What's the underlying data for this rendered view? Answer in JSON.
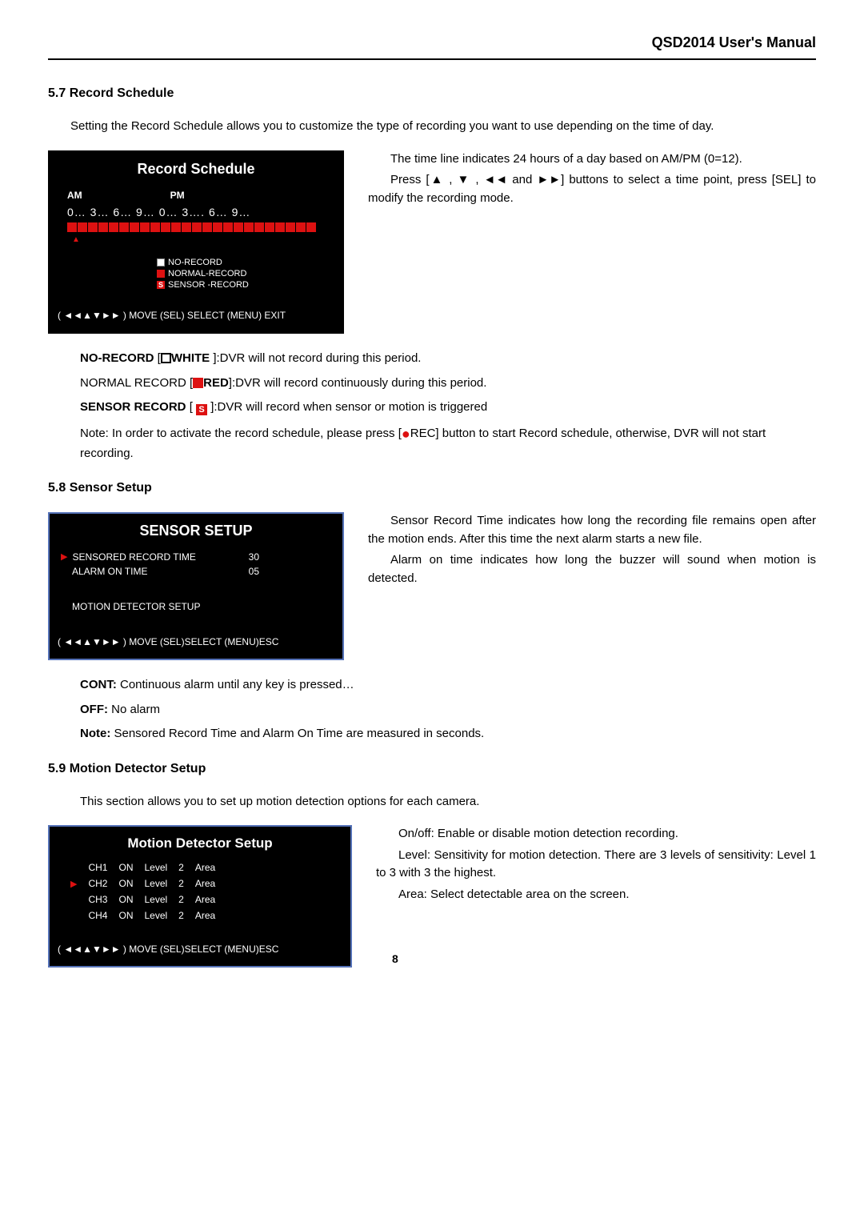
{
  "header": {
    "title": "QSD2014 User's Manual"
  },
  "s57": {
    "title": "5.7 Record Schedule",
    "intro": "Setting the Record Schedule allows you to customize the type of recording you want to use depending on the time of day.",
    "scr": {
      "title": "Record Schedule",
      "am": "AM",
      "pm": "PM",
      "timeline": "0… 3… 6… 9… 0… 3…. 6… 9…",
      "legend1": "NO-RECORD",
      "legend2": "NORMAL-RECORD",
      "legend3_prefix": "S",
      "legend3": "SENSOR -RECORD",
      "footer": "(  ◄◄▲▼►►  ) MOVE (SEL) SELECT (MENU) EXIT"
    },
    "right1": "The time line indicates 24 hours of a day based on AM/PM (0=12).",
    "right2": "Press [▲ , ▼ , ◄◄ and ►►] buttons to select a time point, press [SEL] to modify the recording mode.",
    "nr_label": "NO-RECORD",
    "nr_white": "WHITE",
    "nr_text": " ]:DVR will not record during this period.",
    "norm_label": "NORMAL RECORD [",
    "norm_red": "RED",
    "norm_text": "]:DVR will record continuously during this period.",
    "sr_label": "SENSOR RECORD",
    "sr_s": "S",
    "sr_text": " ]:DVR will record when sensor or motion is triggered",
    "note1": "Note: In order to activate the record schedule, please press [",
    "note_rec": "REC] button to start Record schedule, otherwise, DVR will not start recording."
  },
  "s58": {
    "title": "5.8 Sensor Setup",
    "scr": {
      "title": "SENSOR SETUP",
      "row1": "SENSORED RECORD TIME",
      "row1v": "30",
      "row2": "ALARM ON TIME",
      "row2v": "05",
      "row3": "MOTION DETECTOR SETUP",
      "footer": "(  ◄◄▲▼►►  ) MOVE (SEL)SELECT   (MENU)ESC"
    },
    "right1": "Sensor Record Time indicates how long the recording file remains open after the motion ends. After this time the next alarm starts a new file.",
    "right2": "Alarm on time indicates how long the buzzer will sound when motion is detected.",
    "cont_label": "CONT:",
    "cont_text": " Continuous alarm until any key is pressed…",
    "off_label": "OFF:",
    "off_text": " No alarm",
    "note_label": "Note:",
    "note_text": " Sensored Record Time and Alarm On Time are measured in seconds."
  },
  "s59": {
    "title": "5.9 Motion Detector Setup",
    "intro": "This section allows you to set up motion detection options for each camera.",
    "scr": {
      "title": "Motion Detector Setup",
      "rows": [
        {
          "ch": "CH1",
          "on": "ON",
          "level": "Level",
          "lv": "2",
          "area": "Area",
          "sel": false
        },
        {
          "ch": "CH2",
          "on": "ON",
          "level": "Level",
          "lv": "2",
          "area": "Area",
          "sel": true
        },
        {
          "ch": "CH3",
          "on": "ON",
          "level": "Level",
          "lv": "2",
          "area": "Area",
          "sel": false
        },
        {
          "ch": "CH4",
          "on": "ON",
          "level": "Level",
          "lv": "2",
          "area": "Area",
          "sel": false
        }
      ],
      "footer": "(  ◄◄▲▼►► ) MOVE   (SEL)SELECT   (MENU)ESC"
    },
    "right1": "On/off: Enable or disable motion detection recording.",
    "right2": "Level: Sensitivity for motion detection. There are 3 levels of sensitivity: Level 1 to 3 with 3 the highest.",
    "right3": "Area: Select detectable area on the screen."
  },
  "page": "8"
}
